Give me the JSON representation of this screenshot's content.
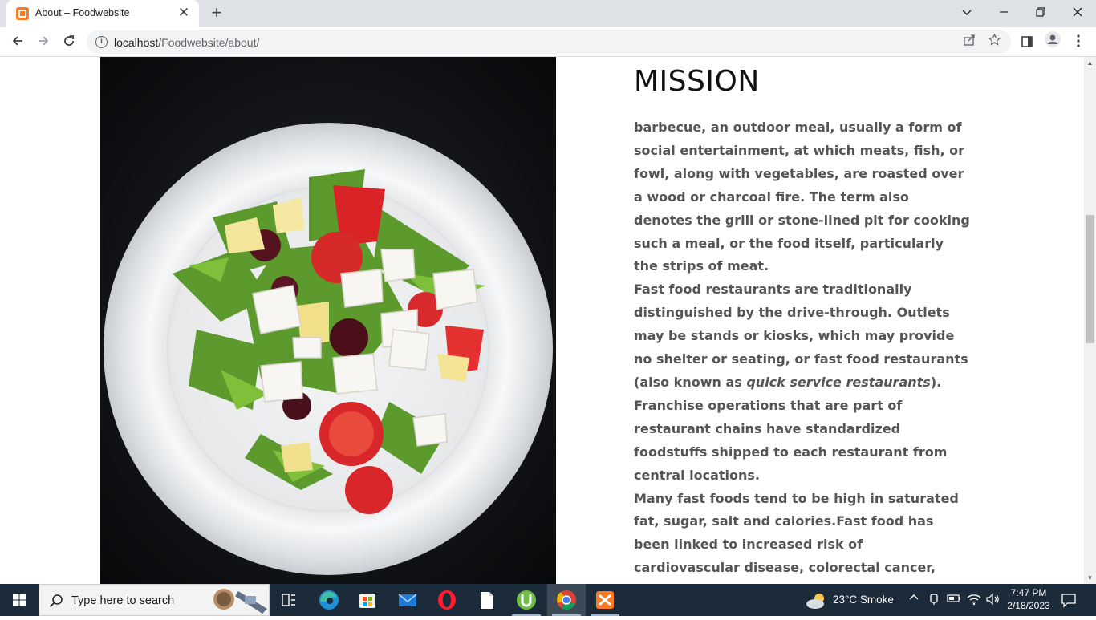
{
  "browser": {
    "tab_title": "About – Foodwebsite",
    "tab_close": "✕",
    "new_tab": "+",
    "url_host": "localhost",
    "url_path": "/Foodwebsite/about/"
  },
  "page": {
    "heading": "MISSION",
    "paragraph_1": "barbecue, an outdoor meal, usually a form of social entertainment, at which meats, fish, or fowl, along with vegetables, are roasted over a wood or charcoal fire. The term also denotes the grill or stone-lined pit for cooking such a meal, or the food itself, particularly the strips of meat.",
    "paragraph_2_before": "Fast food restaurants are traditionally distinguished by the drive-through. Outlets may be stands or kiosks, which may provide no shelter or seating, or fast food restaurants (also known as ",
    "paragraph_2_italic": "quick service restaurants",
    "paragraph_2_after": "). Franchise operations that are part of restaurant chains have standardized foodstuffs shipped to each restaurant from central locations.",
    "paragraph_3": "Many fast foods tend to be high in saturated fat, sugar, salt and calories.Fast food has been linked to increased risk of cardiovascular disease, colorectal cancer, obesity, high cholesterol, insulin resistance conditions and depression. These correlations remain strong even when controlling for"
  },
  "taskbar": {
    "search_placeholder": "Type here to search",
    "weather": "23°C  Smoke",
    "time": "7:47 PM",
    "date": "2/18/2023"
  },
  "icons": [
    "back-icon",
    "forward-icon",
    "reload-icon",
    "info-icon",
    "share-icon",
    "star-icon",
    "side-panel-icon",
    "profile-icon",
    "menu-icon",
    "windows-icon",
    "search-icon",
    "task-view-icon",
    "edge-icon",
    "store-icon",
    "mail-icon",
    "opera-icon",
    "file-icon",
    "utorrent-icon",
    "chrome-icon",
    "xampp-icon"
  ],
  "colors": {
    "accent": "#fb7a24",
    "taskbar": "#1c2b3a",
    "text": "#555555"
  }
}
